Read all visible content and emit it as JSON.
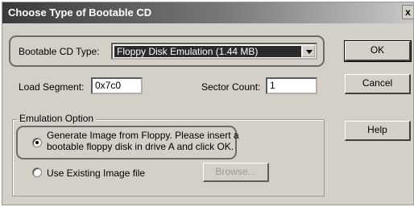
{
  "window": {
    "title": "Choose Type of Bootable CD",
    "close_label": "x"
  },
  "bootable_cd_type": {
    "label": "Bootable CD Type:",
    "selected": "Floppy Disk Emulation (1.44 MB)"
  },
  "load_segment": {
    "label": "Load Segment:",
    "value": "0x7c0"
  },
  "sector_count": {
    "label": "Sector Count:",
    "value": "1"
  },
  "emulation_option": {
    "group_label": "Emulation Option",
    "option_generate": {
      "line1": "Generate Image from Floppy. Please insert a",
      "line2": "bootable floppy disk in drive A and click OK.",
      "selected": true
    },
    "option_existing": {
      "label": "Use Existing Image file",
      "selected": false
    },
    "browse_label": "Browse..."
  },
  "buttons": {
    "ok": "OK",
    "cancel": "Cancel",
    "help": "Help"
  }
}
